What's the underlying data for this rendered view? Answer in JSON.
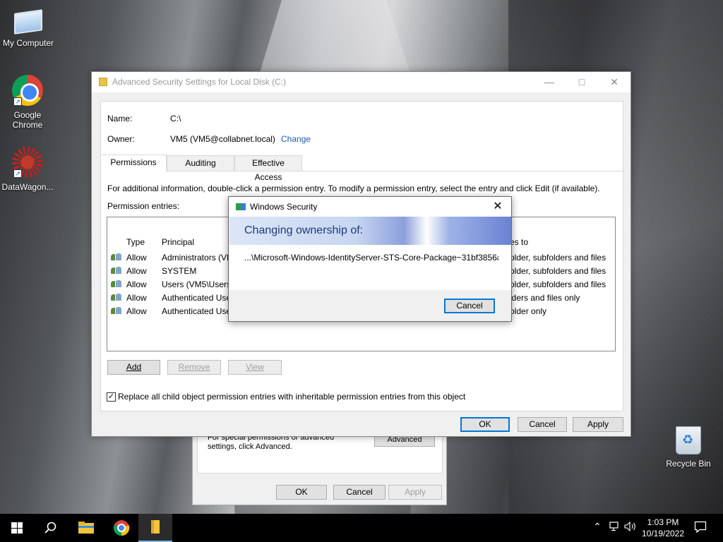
{
  "desktop": {
    "icons": [
      {
        "label": "My Computer"
      },
      {
        "label": "Google Chrome"
      },
      {
        "label": "DataWagon..."
      },
      {
        "label": "Recycle Bin"
      }
    ]
  },
  "properties_window": {
    "info_text": "For special permissions or advanced settings, click Advanced.",
    "advanced_label": "Advanced",
    "ok_label": "OK",
    "cancel_label": "Cancel",
    "apply_label": "Apply"
  },
  "advanced_window": {
    "title": "Advanced Security Settings for Local Disk (C:)",
    "name_label": "Name:",
    "name_value": "C:\\",
    "owner_label": "Owner:",
    "owner_value": "VM5 (VM5@collabnet.local)",
    "change_link": "Change",
    "tabs": [
      {
        "label": "Permissions",
        "active": true
      },
      {
        "label": "Auditing",
        "active": false
      },
      {
        "label": "Effective Access",
        "active": false
      }
    ],
    "info_text": "For additional information, double-click a permission entry. To modify a permission entry, select the entry and click Edit (if available).",
    "entries_label": "Permission entries:",
    "columns": {
      "type": "Type",
      "principal": "Principal",
      "applies": "es to"
    },
    "rows": [
      {
        "type": "Allow",
        "principal": "Administrators (VM",
        "applies": "older, subfolders and files"
      },
      {
        "type": "Allow",
        "principal": "SYSTEM",
        "applies": "older, subfolders and files"
      },
      {
        "type": "Allow",
        "principal": "Users (VM5\\Users)",
        "applies": "older, subfolders and files"
      },
      {
        "type": "Allow",
        "principal": "Authenticated Use",
        "applies": "lders and files only"
      },
      {
        "type": "Allow",
        "principal": "Authenticated Use",
        "applies": "older only"
      }
    ],
    "add_label": "Add",
    "remove_label": "Remove",
    "view_label": "View",
    "replace_checkbox_label": "Replace all child object permission entries with inheritable permission entries from this object",
    "replace_checked": true,
    "ok_label": "OK",
    "cancel_label": "Cancel",
    "apply_label": "Apply"
  },
  "security_dialog": {
    "title": "Windows Security",
    "heading": "Changing ownership of:",
    "path": "...\\Microsoft-Windows-IdentityServer-STS-Core-Package~31bf3856a",
    "cancel_label": "Cancel"
  },
  "taskbar": {
    "time": "1:03 PM",
    "date": "10/19/2022"
  },
  "icons": {
    "start": "windows-logo-icon",
    "search": "search-icon",
    "explorer": "file-explorer-icon",
    "chrome": "chrome-icon",
    "folder": "folder-icon",
    "tray_up": "chevron-up-icon",
    "network": "network-icon",
    "volume": "speaker-icon",
    "notifications": "notification-icon"
  }
}
